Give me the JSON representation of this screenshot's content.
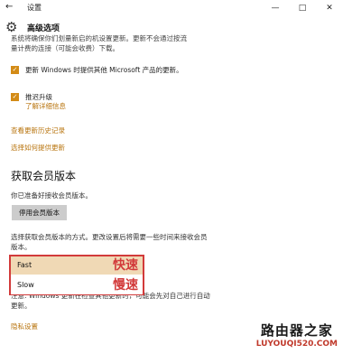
{
  "titlebar": {
    "title": "设置",
    "back_icon": "back-arrow-icon",
    "minimize": "—",
    "maximize": "□",
    "close": "✕"
  },
  "header": {
    "title": "高级选项",
    "icon": "gear-icon"
  },
  "top_cut_text": {
    "line1": "系统将确保你们划量新启的机设置更新。更新不会通过按流",
    "line2": "量计费的连接（可能会收费）下载。"
  },
  "checkboxes": [
    {
      "label": "更新 Windows 时提供其他 Microsoft 产品的更新。",
      "checked": true
    },
    {
      "label": "推迟升级",
      "checked": true,
      "sub_link": "了解详细信息"
    }
  ],
  "links": {
    "history": "查看更新历史记录",
    "delivery": "选择如何提供更新",
    "privacy": "隐私设置"
  },
  "insider": {
    "section_title": "获取会员版本",
    "ready_text": "你已准备好接收会员版本。",
    "stop_button": "停用会员版本",
    "choose_text_1": "选择获取会员版本的方式。更改设置后将需要一些时间来接收会员",
    "choose_text_2": "版本。",
    "options": [
      {
        "label": "Fast",
        "annotation": "快速",
        "selected": true
      },
      {
        "label": "Slow",
        "annotation": "慢速",
        "selected": false
      }
    ],
    "note_text_1": "注意: Windows 更新在检查其他更新时，可能会先对自己进行自动",
    "note_text_2": "更新。"
  },
  "watermark": {
    "top": "路由器之家",
    "bottom": "LUYOUQI520.COM"
  },
  "colors": {
    "accent": "#d38b16",
    "link": "#b8740e",
    "highlight_red": "#d23a3a",
    "selected_option": "#f0d9b5"
  }
}
